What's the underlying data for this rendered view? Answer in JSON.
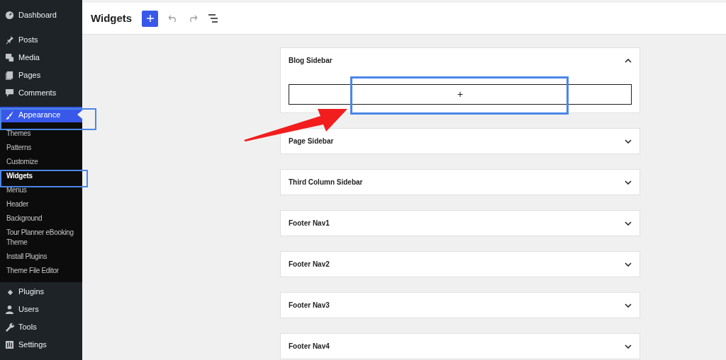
{
  "sidebar": {
    "items": [
      {
        "label": "Dashboard",
        "selected": false
      },
      {
        "label": "Posts",
        "selected": false
      },
      {
        "label": "Media",
        "selected": false
      },
      {
        "label": "Pages",
        "selected": false
      },
      {
        "label": "Comments",
        "selected": false
      },
      {
        "label": "Appearance",
        "selected": true,
        "children": [
          {
            "label": "Themes",
            "selected": false
          },
          {
            "label": "Patterns",
            "selected": false
          },
          {
            "label": "Customize",
            "selected": false
          },
          {
            "label": "Widgets",
            "selected": true
          },
          {
            "label": "Menus",
            "selected": false
          },
          {
            "label": "Header",
            "selected": false
          },
          {
            "label": "Background",
            "selected": false
          },
          {
            "label": "Tour Planner eBooking Theme",
            "selected": false
          },
          {
            "label": "Install Plugins",
            "selected": false
          },
          {
            "label": "Theme File Editor",
            "selected": false
          }
        ]
      },
      {
        "label": "Plugins",
        "selected": false
      },
      {
        "label": "Users",
        "selected": false
      },
      {
        "label": "Tools",
        "selected": false
      },
      {
        "label": "Settings",
        "selected": false
      }
    ]
  },
  "header": {
    "title": "Widgets"
  },
  "areas": [
    {
      "title": "Blog Sidebar",
      "expanded": true,
      "add_block": "+"
    },
    {
      "title": "Page Sidebar",
      "expanded": false
    },
    {
      "title": "Third Column Sidebar",
      "expanded": false
    },
    {
      "title": "Footer Nav1",
      "expanded": false
    },
    {
      "title": "Footer Nav2",
      "expanded": false
    },
    {
      "title": "Footer Nav3",
      "expanded": false
    },
    {
      "title": "Footer Nav4",
      "expanded": false
    }
  ]
}
